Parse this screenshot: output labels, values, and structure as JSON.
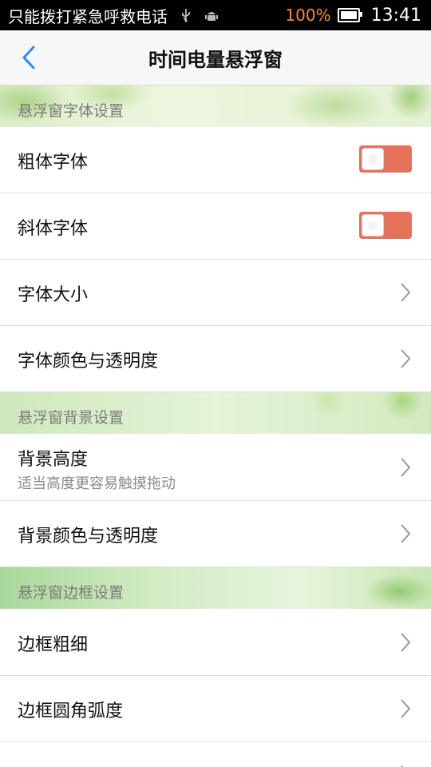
{
  "status_bar": {
    "carrier_text": "只能拨打紧急呼救电话",
    "icons": [
      "usb-icon",
      "android-debug-icon"
    ],
    "battery_percent_text": "100%",
    "battery_level": 1.0,
    "time": "13:41",
    "battery_color": "#ff8a1f"
  },
  "header": {
    "title": "时间电量悬浮窗",
    "back_icon": "chevron-left-icon",
    "accent_color": "#2a8cf0"
  },
  "sections": [
    {
      "title": "悬浮窗字体设置",
      "rows": [
        {
          "label": "粗体字体",
          "control": "toggle",
          "on": true
        },
        {
          "label": "斜体字体",
          "control": "toggle",
          "on": true
        },
        {
          "label": "字体大小",
          "control": "chevron"
        },
        {
          "label": "字体颜色与透明度",
          "control": "chevron"
        }
      ]
    },
    {
      "title": "悬浮窗背景设置",
      "rows": [
        {
          "label": "背景高度",
          "sublabel": "适当高度更容易触摸拖动",
          "control": "chevron"
        },
        {
          "label": "背景颜色与透明度",
          "control": "chevron"
        }
      ]
    },
    {
      "title": "悬浮窗边框设置",
      "rows": [
        {
          "label": "边框粗细",
          "control": "chevron"
        },
        {
          "label": "边框圆角弧度",
          "control": "chevron"
        },
        {
          "label": "",
          "control": "chevron"
        }
      ]
    }
  ],
  "toggle_color": "#e5715b"
}
